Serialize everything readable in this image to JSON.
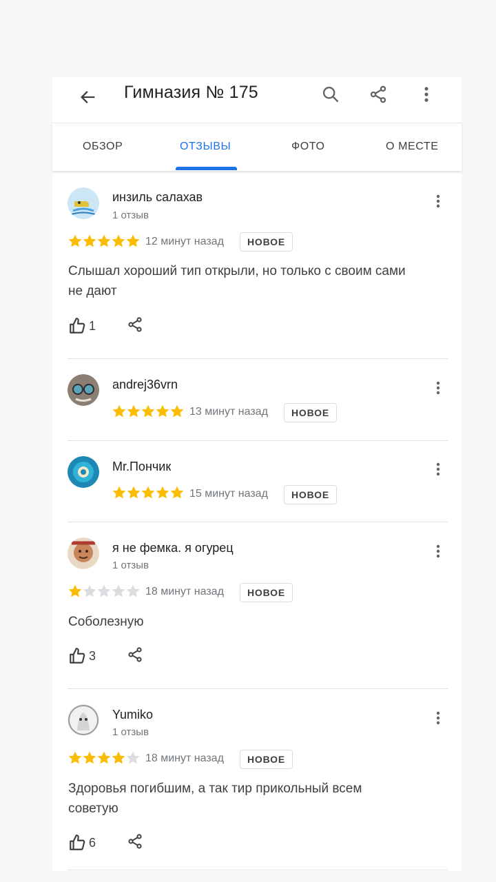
{
  "header": {
    "title": "Гимназия № 175",
    "back_icon": "arrow-left-icon",
    "search_icon": "search-icon",
    "share_icon": "share-icon",
    "more_icon": "more-vert-icon"
  },
  "tabs": [
    {
      "label": "ОБЗОР",
      "active": false
    },
    {
      "label": "ОТЗЫВЫ",
      "active": true
    },
    {
      "label": "ФОТО",
      "active": false
    },
    {
      "label": "О МЕСТЕ",
      "active": false
    }
  ],
  "colors": {
    "accent": "#1a73e8",
    "star_filled": "#fbbc04",
    "star_empty": "#dadce0"
  },
  "reviews": [
    {
      "author": "инзиль салахав",
      "review_count": "1 отзыв",
      "rating": 5,
      "time": "12 минут назад",
      "badge": "НОВОЕ",
      "text": "Слышал хороший тип открыли, но только с своим сами не дают",
      "likes": "1"
    },
    {
      "author": "andrej36vrn",
      "rating": 5,
      "time": "13 минут назад",
      "badge": "НОВОЕ"
    },
    {
      "author": "Mr.Пончик",
      "rating": 5,
      "time": "15 минут назад",
      "badge": "НОВОЕ"
    },
    {
      "author": "я не фемка. я огурец",
      "review_count": "1 отзыв",
      "rating": 1,
      "time": "18 минут назад",
      "badge": "НОВОЕ",
      "text": "Соболезную",
      "likes": "3"
    },
    {
      "author": "Yumiko",
      "review_count": "1 отзыв",
      "rating": 4,
      "time": "18 минут назад",
      "badge": "НОВОЕ",
      "text": "Здоровья погибшим, а так тир прикольный всем советую",
      "likes": "6"
    }
  ]
}
